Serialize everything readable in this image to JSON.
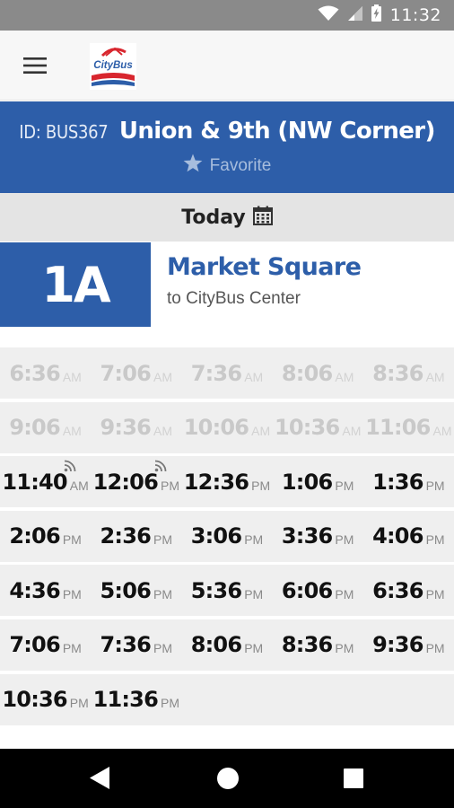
{
  "status_bar": {
    "time": "11:32",
    "icons": [
      "wifi-icon",
      "signal-icon",
      "battery-charging-icon"
    ]
  },
  "app_bar": {
    "menu_icon": "hamburger-menu-icon",
    "logo_text": "CityBus"
  },
  "stop": {
    "id_label": "ID: BUS367",
    "name": "Union & 9th (NW Corner)",
    "favorite_label": "Favorite",
    "favorite_icon": "star-icon"
  },
  "day": {
    "label": "Today",
    "icon": "calendar-icon"
  },
  "route": {
    "number": "1A",
    "name": "Market Square",
    "destination": "to CityBus Center"
  },
  "schedule": {
    "rows": [
      [
        {
          "time": "6:36",
          "period": "AM",
          "past": true,
          "realtime": false
        },
        {
          "time": "7:06",
          "period": "AM",
          "past": true,
          "realtime": false
        },
        {
          "time": "7:36",
          "period": "AM",
          "past": true,
          "realtime": false
        },
        {
          "time": "8:06",
          "period": "AM",
          "past": true,
          "realtime": false
        },
        {
          "time": "8:36",
          "period": "AM",
          "past": true,
          "realtime": false
        }
      ],
      [
        {
          "time": "9:06",
          "period": "AM",
          "past": true,
          "realtime": false
        },
        {
          "time": "9:36",
          "period": "AM",
          "past": true,
          "realtime": false
        },
        {
          "time": "10:06",
          "period": "AM",
          "past": true,
          "realtime": false
        },
        {
          "time": "10:36",
          "period": "AM",
          "past": true,
          "realtime": false
        },
        {
          "time": "11:06",
          "period": "AM",
          "past": true,
          "realtime": false
        }
      ],
      [
        {
          "time": "11:40",
          "period": "AM",
          "past": false,
          "realtime": true
        },
        {
          "time": "12:06",
          "period": "PM",
          "past": false,
          "realtime": true
        },
        {
          "time": "12:36",
          "period": "PM",
          "past": false,
          "realtime": false
        },
        {
          "time": "1:06",
          "period": "PM",
          "past": false,
          "realtime": false
        },
        {
          "time": "1:36",
          "period": "PM",
          "past": false,
          "realtime": false
        }
      ],
      [
        {
          "time": "2:06",
          "period": "PM",
          "past": false,
          "realtime": false
        },
        {
          "time": "2:36",
          "period": "PM",
          "past": false,
          "realtime": false
        },
        {
          "time": "3:06",
          "period": "PM",
          "past": false,
          "realtime": false
        },
        {
          "time": "3:36",
          "period": "PM",
          "past": false,
          "realtime": false
        },
        {
          "time": "4:06",
          "period": "PM",
          "past": false,
          "realtime": false
        }
      ],
      [
        {
          "time": "4:36",
          "period": "PM",
          "past": false,
          "realtime": false
        },
        {
          "time": "5:06",
          "period": "PM",
          "past": false,
          "realtime": false
        },
        {
          "time": "5:36",
          "period": "PM",
          "past": false,
          "realtime": false
        },
        {
          "time": "6:06",
          "period": "PM",
          "past": false,
          "realtime": false
        },
        {
          "time": "6:36",
          "period": "PM",
          "past": false,
          "realtime": false
        }
      ],
      [
        {
          "time": "7:06",
          "period": "PM",
          "past": false,
          "realtime": false
        },
        {
          "time": "7:36",
          "period": "PM",
          "past": false,
          "realtime": false
        },
        {
          "time": "8:06",
          "period": "PM",
          "past": false,
          "realtime": false
        },
        {
          "time": "8:36",
          "period": "PM",
          "past": false,
          "realtime": false
        },
        {
          "time": "9:36",
          "period": "PM",
          "past": false,
          "realtime": false
        }
      ],
      [
        {
          "time": "10:36",
          "period": "PM",
          "past": false,
          "realtime": false
        },
        {
          "time": "11:36",
          "period": "PM",
          "past": false,
          "realtime": false
        }
      ]
    ]
  },
  "nav_bar": {
    "icons": [
      "back-icon",
      "home-icon",
      "recents-icon"
    ]
  },
  "colors": {
    "brand_blue": "#2d5ea9",
    "status_bar": "#8a8a8a",
    "row_background": "#efefef",
    "past_time": "#c9c9c9"
  }
}
